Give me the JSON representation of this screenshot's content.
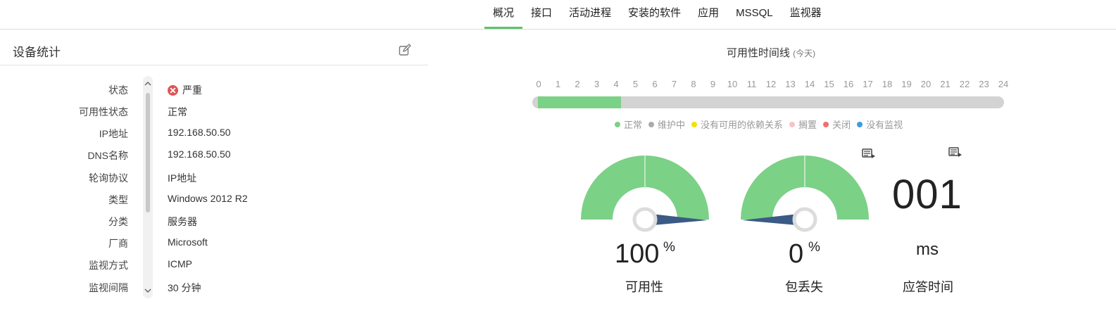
{
  "tabs": [
    {
      "label": "概况",
      "active": true
    },
    {
      "label": "接口",
      "active": false
    },
    {
      "label": "活动进程",
      "active": false
    },
    {
      "label": "安装的软件",
      "active": false
    },
    {
      "label": "应用",
      "active": false
    },
    {
      "label": "MSSQL",
      "active": false
    },
    {
      "label": "监视器",
      "active": false
    }
  ],
  "device_stats": {
    "title": "设备统计",
    "edit_icon": "edit-icon",
    "properties": [
      {
        "label": "状态",
        "value": "严重",
        "icon": "critical-icon"
      },
      {
        "label": "可用性状态",
        "value": "正常"
      },
      {
        "label": "IP地址",
        "value": "192.168.50.50"
      },
      {
        "label": "DNS名称",
        "value": "192.168.50.50"
      },
      {
        "label": "轮询协议",
        "value": "IP地址"
      },
      {
        "label": "类型",
        "value": "Windows 2012 R2"
      },
      {
        "label": "分类",
        "value": "服务器"
      },
      {
        "label": "厂商",
        "value": "Microsoft"
      },
      {
        "label": "监视方式",
        "value": "ICMP"
      },
      {
        "label": "监视间隔",
        "value": "30 分钟"
      }
    ]
  },
  "timeline": {
    "title": "可用性时间线",
    "subtitle": "(今天)",
    "hours": [
      "0",
      "1",
      "2",
      "3",
      "4",
      "5",
      "6",
      "7",
      "8",
      "9",
      "10",
      "11",
      "12",
      "13",
      "14",
      "15",
      "16",
      "17",
      "18",
      "19",
      "20",
      "21",
      "22",
      "23",
      "24"
    ],
    "up_from_hour": 0.3,
    "up_to_hour": 4.5,
    "legend": [
      {
        "label": "正常",
        "color": "#7bd186"
      },
      {
        "label": "维护中",
        "color": "#aaaaaa"
      },
      {
        "label": "没有可用的依赖关系",
        "color": "#f5e000"
      },
      {
        "label": "搁置",
        "color": "#f8c2c8"
      },
      {
        "label": "关闭",
        "color": "#f07070"
      },
      {
        "label": "没有监视",
        "color": "#3a9de0"
      }
    ]
  },
  "gauges": {
    "availability": {
      "value": "100",
      "unit": "%",
      "label": "可用性",
      "percent": 100
    },
    "packet_loss": {
      "value": "0",
      "unit": "%",
      "label": "包丢失",
      "percent": 0
    }
  },
  "response_time": {
    "value": "001",
    "unit": "ms",
    "label": "应答时间"
  },
  "colors": {
    "accent": "#5bc46a",
    "gauge_fill": "#7bd186",
    "needle": "#3b5a85",
    "critical": "#e05454"
  },
  "icons": {
    "report": "report-icon",
    "scroll_up": "chevron-up-icon",
    "scroll_down": "chevron-down-icon"
  }
}
